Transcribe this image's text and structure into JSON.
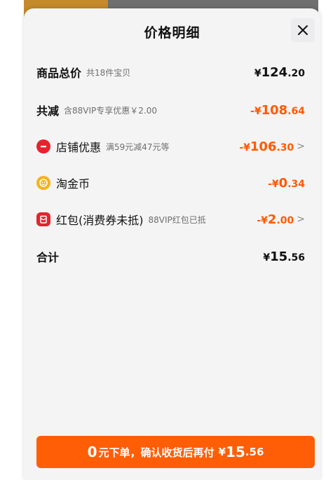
{
  "sheet": {
    "title": "价格明细",
    "close_icon": "close-icon"
  },
  "rows": [
    {
      "label": "商品总价",
      "sub": "共18件宝贝",
      "currency": "¥",
      "int": "124",
      "dec": ".20",
      "color": "#111111"
    },
    {
      "label": "共减",
      "sub": "含88VIP专享优惠￥2.00",
      "currency": "-¥",
      "int": "108",
      "dec": ".64",
      "color": "#ff5a00"
    },
    {
      "label": "店铺优惠",
      "sub": "满59元减47元等",
      "currency": "-¥",
      "int": "106",
      "dec": ".30",
      "color": "#ff5a00",
      "icon": "shop-discount-icon",
      "chevron": ">"
    },
    {
      "label": "淘金币",
      "sub": "",
      "currency": "-¥",
      "int": "0",
      "dec": ".34",
      "color": "#ff5a00",
      "icon": "coin-icon"
    },
    {
      "label": "红包(消费券未抵)",
      "sub": "88VIP红包已抵",
      "currency": "-¥",
      "int": "2",
      "dec": ".00",
      "color": "#ff5a00",
      "icon": "red-envelope-icon",
      "chevron": ">"
    },
    {
      "label": "合计",
      "sub": "",
      "currency": "¥",
      "int": "15",
      "dec": ".56",
      "color": "#111111"
    }
  ],
  "cta": {
    "big": "0",
    "text": "元下单，确认收货后再付",
    "currency": "¥",
    "int": "15",
    "dec": ".56",
    "color": "#ff5e07"
  }
}
